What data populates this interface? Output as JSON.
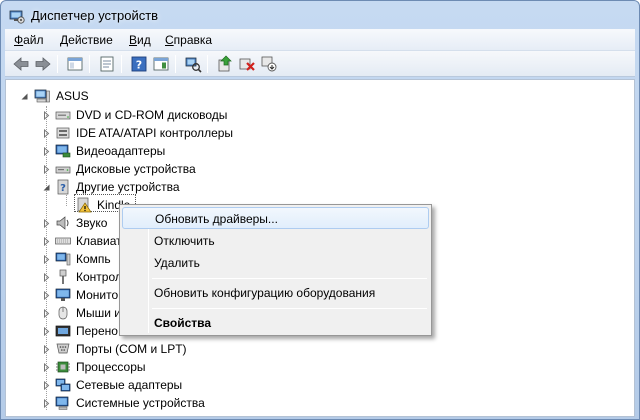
{
  "window": {
    "title": "Диспетчер устройств"
  },
  "menubar": {
    "items": [
      {
        "label": "Файл",
        "underline": "Ф",
        "rest": "айл"
      },
      {
        "label": "Действие",
        "underline": "Д",
        "rest": "ействие"
      },
      {
        "label": "Вид",
        "underline": "В",
        "rest": "ид"
      },
      {
        "label": "Справка",
        "underline": "С",
        "rest": "правка"
      }
    ]
  },
  "toolbar": {
    "buttons": [
      "back-icon",
      "forward-icon",
      "show-hide-tree-icon",
      "properties-icon",
      "help-icon",
      "action-pane-icon",
      "scan-hardware-icon",
      "update-driver-icon",
      "uninstall-icon",
      "disable-icon"
    ]
  },
  "tree": {
    "root": "ASUS",
    "items": [
      {
        "label": "DVD и CD-ROM дисководы",
        "icon": "optical-drive-icon"
      },
      {
        "label": "IDE ATA/ATAPI контроллеры",
        "icon": "ide-controller-icon"
      },
      {
        "label": "Видеоадаптеры",
        "icon": "display-adapter-icon"
      },
      {
        "label": "Дисковые устройства",
        "icon": "disk-drive-icon"
      },
      {
        "label": "Другие устройства",
        "icon": "other-devices-icon",
        "expanded": true
      },
      {
        "label": "Kindle",
        "icon": "warning-device-icon",
        "child": true
      },
      {
        "label": "Звуковые, видео и игровые устройства",
        "visible": "Звуко",
        "icon": "speaker-icon"
      },
      {
        "label": "Клавиатуры",
        "visible": "Клавиат",
        "icon": "keyboard-icon"
      },
      {
        "label": "Компьютер",
        "visible": "Компь",
        "icon": "computer-icon"
      },
      {
        "label": "Контроллеры",
        "visible": "Контрол",
        "icon": "usb-controller-icon"
      },
      {
        "label": "Мониторы",
        "visible": "Монито",
        "icon": "monitor-icon"
      },
      {
        "label": "Мыши и иные указывающие устройства",
        "visible": "Мыши и",
        "icon": "mouse-icon"
      },
      {
        "label": "Переносные устройства",
        "visible": "Перено",
        "icon": "portable-device-icon"
      },
      {
        "label": "Порты (COM и LPT)",
        "icon": "port-icon"
      },
      {
        "label": "Процессоры",
        "icon": "processor-icon"
      },
      {
        "label": "Сетевые адаптеры",
        "icon": "network-adapter-icon"
      },
      {
        "label": "Системные устройства",
        "icon": "system-device-icon"
      }
    ]
  },
  "context_menu": {
    "update_drivers": "Обновить драйверы...",
    "disable": "Отключить",
    "uninstall": "Удалить",
    "scan_hardware": "Обновить конфигурацию оборудования",
    "properties": "Свойства"
  },
  "colors": {
    "accent": "#3c6ea5",
    "warning": "#f3c23c",
    "selection": "#e1eefc"
  }
}
